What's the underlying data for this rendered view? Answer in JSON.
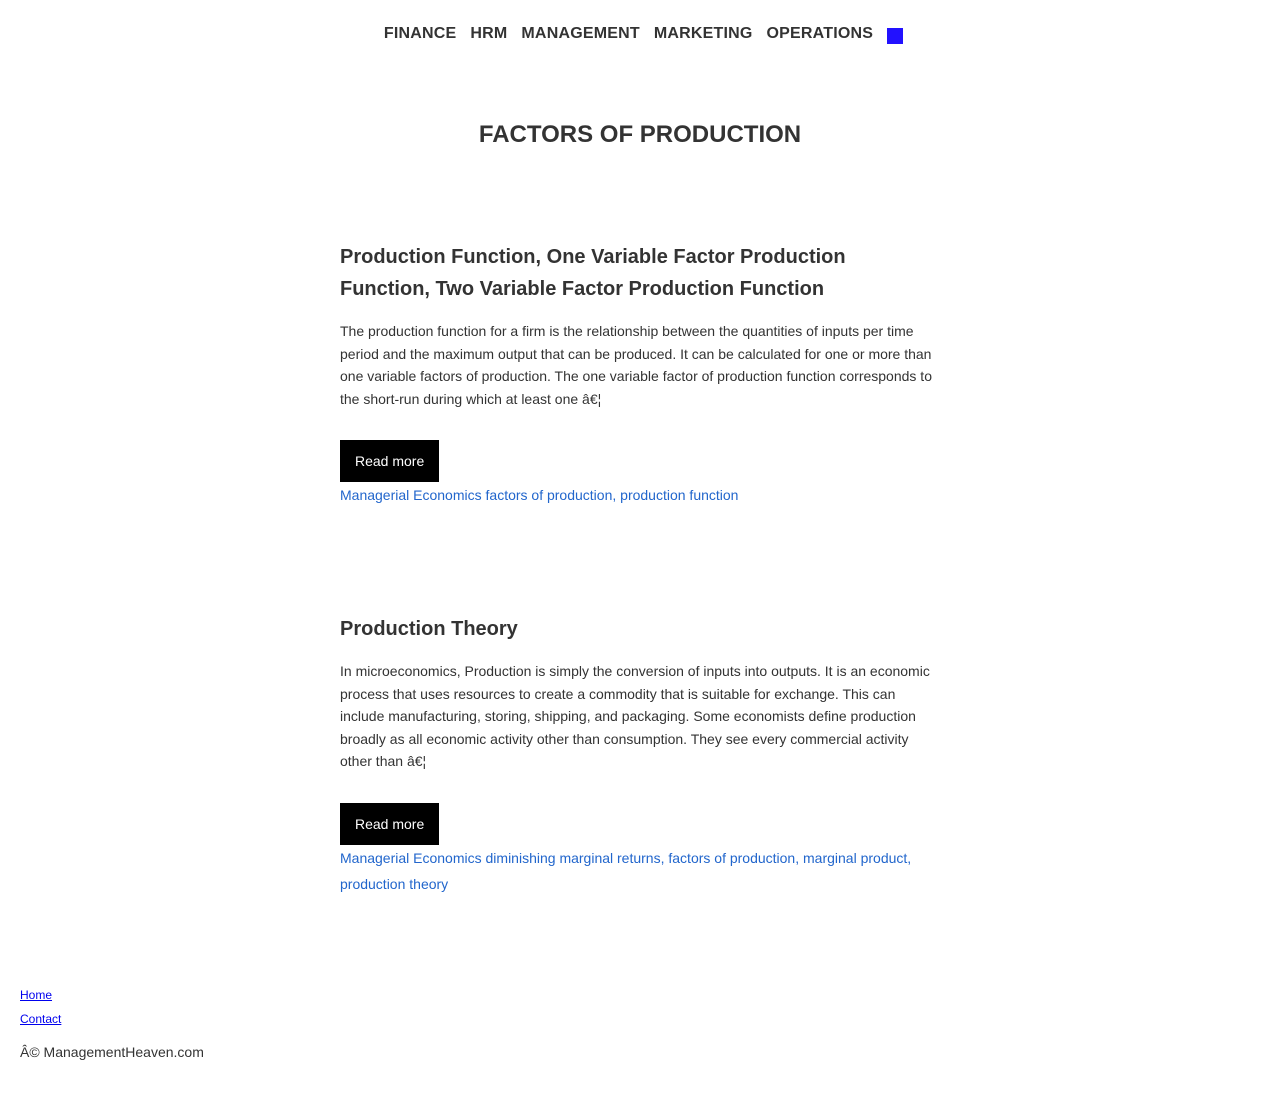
{
  "nav": {
    "items": [
      {
        "label": "FINANCE"
      },
      {
        "label": "HRM"
      },
      {
        "label": "MANAGEMENT"
      },
      {
        "label": "MARKETING"
      },
      {
        "label": "OPERATIONS"
      }
    ],
    "square_color": "#2211ff"
  },
  "page": {
    "title": "FACTORS OF PRODUCTION"
  },
  "posts": [
    {
      "title": "Production Function, One Variable Factor Production Function, Two Variable Factor Production Function",
      "excerpt": "The production function for a firm is the relationship between the quantities of inputs per time period and the maximum output that can be produced. It can be calculated for one or more than one variable factors of production. The one variable factor of production function corresponds to the short-run during which at least one â€¦",
      "read_more": "Read more",
      "category": "Managerial Economics",
      "tags": [
        "factors of production",
        "production function"
      ]
    },
    {
      "title": "Production Theory",
      "excerpt": "In microeconomics, Production is simply the conversion of inputs into outputs. It is an economic process that uses resources to create a commodity that is suitable for exchange. This can include manufacturing, storing, shipping, and packaging. Some economists define production broadly as all economic activity other than consumption. They see every commercial activity other than â€¦",
      "read_more": "Read more",
      "category": "Managerial Economics",
      "tags": [
        "diminishing marginal returns",
        "factors of production",
        "marginal product",
        "production theory"
      ]
    }
  ],
  "footer": {
    "links": [
      {
        "label": "Home"
      },
      {
        "label": "Contact"
      }
    ],
    "copyright": "Â© ManagementHeaven.com"
  },
  "colors": {
    "text": "#333333",
    "link": "#2266cc",
    "button_bg": "#000000",
    "button_text": "#ffffff",
    "footer_link": "#0000ee"
  }
}
